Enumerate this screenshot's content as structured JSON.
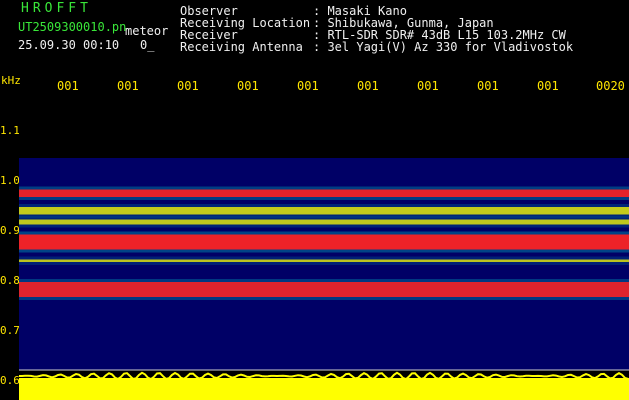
{
  "header": {
    "app_title": "HROFFT",
    "filename": "UT2509300010.pn",
    "filename_suffix": "meteor",
    "datetime": "25.09.30 00:10",
    "count": "0_"
  },
  "station": {
    "rows": [
      {
        "label": "Observer",
        "value": ": Masaki Kano"
      },
      {
        "label": "Receiving Location",
        "value": ": Shibukawa, Gunma, Japan"
      },
      {
        "label": "Receiver",
        "value": ": RTL-SDR SDR# 43dB L15 103.2MHz CW"
      },
      {
        "label": "Receiving Antenna",
        "value": ": 3el Yagi(V) Az 330 for Vladivostok"
      }
    ]
  },
  "y_axis": {
    "unit": "kHz",
    "ticks": [
      "1.1",
      "1.0",
      "0.9",
      "0.8",
      "0.7",
      "0.6"
    ]
  },
  "x_axis": {
    "ticks": [
      "001",
      "001",
      "001",
      "001",
      "001",
      "001",
      "001",
      "001",
      "001",
      "0020"
    ]
  },
  "colors": {
    "background": "#000000",
    "noise_floor": "#000066",
    "signal_mid": "#00c8c8",
    "signal_high": "#ffff00",
    "signal_peak": "#ff2020",
    "audio_level": "#ffff00"
  },
  "spectrogram": {
    "top_frequency_khz": 1.05,
    "bands": [
      {
        "from_khz": 0.985,
        "to_khz": 0.97,
        "strength": 0.85
      },
      {
        "from_khz": 0.95,
        "to_khz": 0.935,
        "strength": 0.55
      },
      {
        "from_khz": 0.925,
        "to_khz": 0.915,
        "strength": 0.5
      },
      {
        "from_khz": 0.895,
        "to_khz": 0.865,
        "strength": 0.95
      },
      {
        "from_khz": 0.845,
        "to_khz": 0.84,
        "strength": 0.45
      },
      {
        "from_khz": 0.8,
        "to_khz": 0.77,
        "strength": 0.8
      }
    ]
  }
}
